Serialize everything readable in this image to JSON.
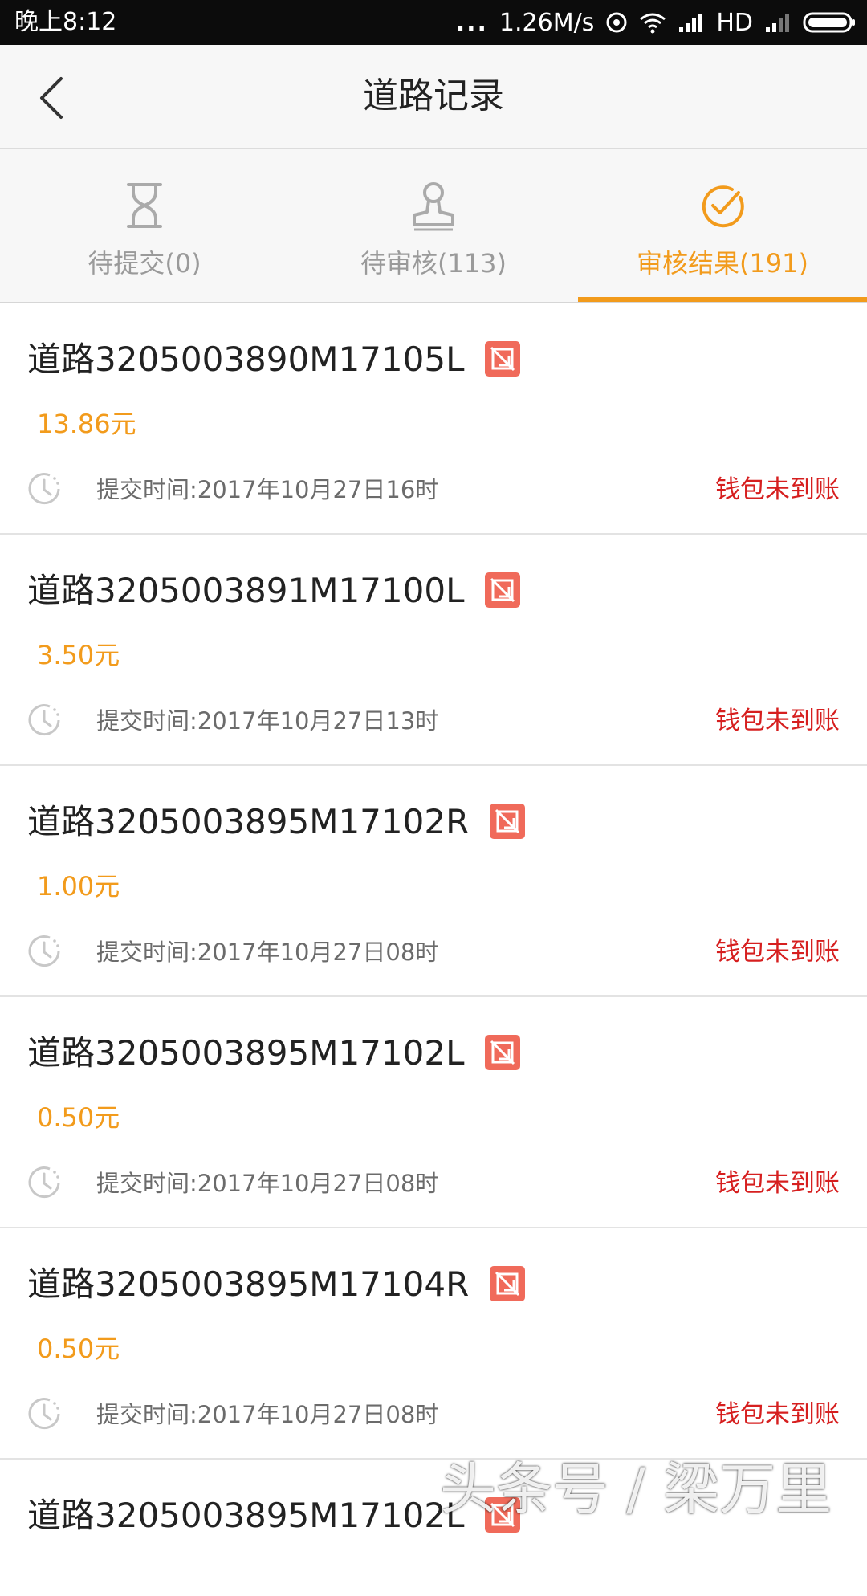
{
  "status_bar": {
    "time": "晚上8:12",
    "dots": "...",
    "speed": "1.26M/s",
    "hd": "HD"
  },
  "header": {
    "title": "道路记录",
    "back_icon": "chevron-left-icon"
  },
  "tabs": [
    {
      "label": "待提交(0)",
      "icon": "hourglass-icon",
      "active": false
    },
    {
      "label": "待审核(113)",
      "icon": "stamp-icon",
      "active": false
    },
    {
      "label": "审核结果(191)",
      "icon": "check-circle-icon",
      "active": true
    }
  ],
  "records": [
    {
      "name": "道路3205003890M17105L",
      "amount": "13.86元",
      "submit_time": "提交时间:2017年10月27日16时",
      "status": "钱包未到账"
    },
    {
      "name": "道路3205003891M17100L",
      "amount": "3.50元",
      "submit_time": "提交时间:2017年10月27日13时",
      "status": "钱包未到账"
    },
    {
      "name": "道路3205003895M17102R",
      "amount": "1.00元",
      "submit_time": "提交时间:2017年10月27日08时",
      "status": "钱包未到账"
    },
    {
      "name": "道路3205003895M17102L",
      "amount": "0.50元",
      "submit_time": "提交时间:2017年10月27日08时",
      "status": "钱包未到账"
    },
    {
      "name": "道路3205003895M17104R",
      "amount": "0.50元",
      "submit_time": "提交时间:2017年10月27日08时",
      "status": "钱包未到账"
    },
    {
      "name": "道路3205003895M17102L"
    }
  ],
  "watermark": "头条号 / 梁万里",
  "colors": {
    "accent": "#f29b1c",
    "status_red": "#d61f1f",
    "badge_red": "#f06a5a",
    "status_bar_bg": "#0c0c0c"
  }
}
